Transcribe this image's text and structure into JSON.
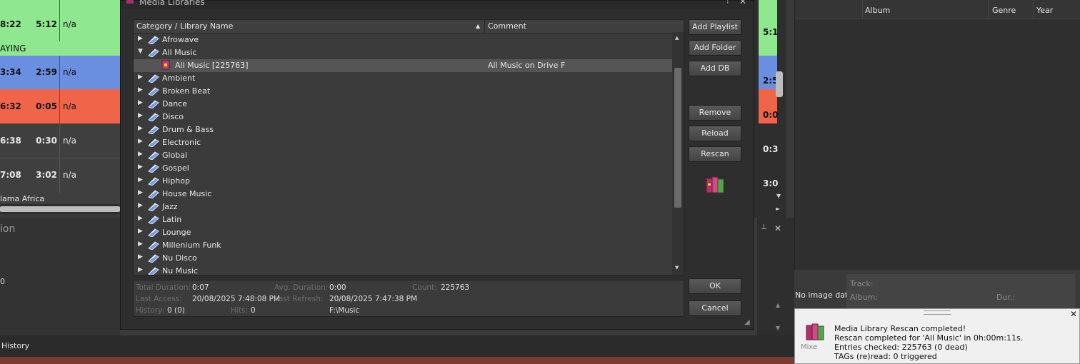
{
  "playlist": {
    "rows": [
      {
        "time": "8:22",
        "duration": "5:12",
        "value": "n/a",
        "extra": "AYING",
        "color": "#8fe88f"
      },
      {
        "time": "3:34",
        "duration": "2:59",
        "value": "n/a",
        "extra": "",
        "color": "#6a8fe0"
      },
      {
        "time": "6:32",
        "duration": "0:05",
        "value": "n/a",
        "extra": "",
        "color": "#f0654a"
      },
      {
        "time": "6:38",
        "duration": "0:30",
        "value": "n/a",
        "extra": "",
        "color": "#3f3f3f"
      },
      {
        "time": "7:08",
        "duration": "3:02",
        "value": "n/a",
        "extra": "lama Africa",
        "color": "#3f3f3f"
      }
    ],
    "lower_label": "ion",
    "lower_value": "0",
    "history_tab": "History"
  },
  "dialog": {
    "title": "Media Libraries",
    "columns": {
      "name": "Category / Library Name",
      "comment": "Comment"
    },
    "items": [
      {
        "label": "Afrowave",
        "expanded": false,
        "child": false
      },
      {
        "label": "All Music",
        "expanded": true,
        "child": false
      },
      {
        "label": "All Music [225763]",
        "comment": "All Music on Drive F",
        "child": true,
        "selected": true
      },
      {
        "label": "Ambient",
        "expanded": false,
        "child": false
      },
      {
        "label": "Broken Beat",
        "expanded": false,
        "child": false
      },
      {
        "label": "Dance",
        "expanded": false,
        "child": false
      },
      {
        "label": "Disco",
        "expanded": false,
        "child": false
      },
      {
        "label": "Drum & Bass",
        "expanded": false,
        "child": false
      },
      {
        "label": "Electronic",
        "expanded": false,
        "child": false
      },
      {
        "label": "Global",
        "expanded": false,
        "child": false
      },
      {
        "label": "Gospel",
        "expanded": false,
        "child": false
      },
      {
        "label": "Hiphop",
        "expanded": false,
        "child": false
      },
      {
        "label": "House Music",
        "expanded": false,
        "child": false
      },
      {
        "label": "Jazz",
        "expanded": false,
        "child": false
      },
      {
        "label": "Latin",
        "expanded": false,
        "child": false
      },
      {
        "label": "Lounge",
        "expanded": false,
        "child": false
      },
      {
        "label": "Millenium Funk",
        "expanded": false,
        "child": false
      },
      {
        "label": "Nu Disco",
        "expanded": false,
        "child": false
      },
      {
        "label": "Nu Music",
        "expanded": false,
        "child": false
      }
    ],
    "buttons": {
      "add_playlist": "Add Playlist",
      "add_folder": "Add Folder",
      "add_db": "Add DB",
      "remove": "Remove",
      "reload": "Reload",
      "rescan": "Rescan",
      "ok": "OK",
      "cancel": "Cancel"
    },
    "stats": {
      "total_duration_label": "Total Duration:",
      "total_duration": "0:07",
      "avg_duration_label": "Avg. Duration:",
      "avg_duration": "0:00",
      "count_label": "Count:",
      "count": "225763",
      "last_access_label": "Last Access:",
      "last_access": "20/08/2025 7:48:08 PM",
      "last_refresh_label": "Last Refresh:",
      "last_refresh": "20/08/2025 7:47:38 PM",
      "history_label": "History:",
      "history": "0 (0)",
      "hits_label": "Hits:",
      "hits": "0",
      "path": "F:\\Music"
    }
  },
  "left_edge_values": [
    "5:1",
    "2:5",
    "0:0",
    "0:3",
    "3:0"
  ],
  "right_panel": {
    "columns": {
      "album": "Album",
      "genre": "Genre",
      "year": "Year"
    },
    "no_image": "No image data",
    "fields": {
      "track": "Track:",
      "album": "Album:",
      "dur": "Dur.:"
    }
  },
  "notification": {
    "line1": "Media Library Rescan completed!",
    "line2": "Rescan completed for 'All Music' in 0h:00m:11s.",
    "line3": "Entries checked: 225763 (0 dead)",
    "line4": "TAGs (re)read: 0 triggered",
    "peek": "Mixe"
  },
  "colors": {
    "accent_green": "#8fe88f",
    "accent_blue": "#6a8fe0",
    "accent_red": "#f0654a"
  }
}
